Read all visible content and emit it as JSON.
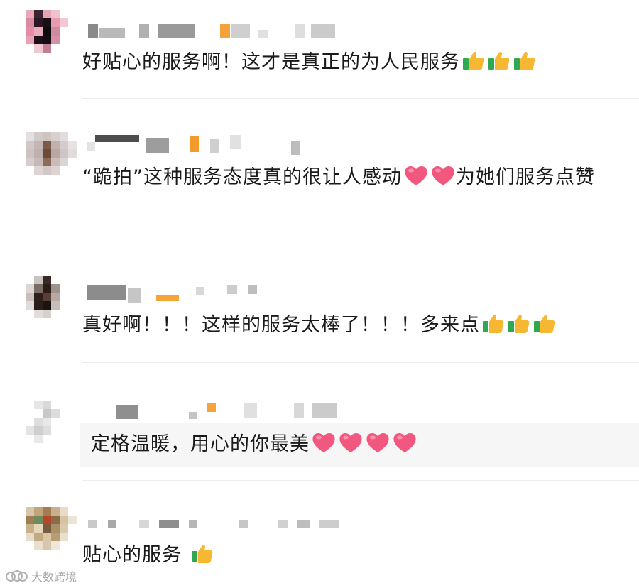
{
  "comments": [
    {
      "text": "好贴心的服务啊！这才是真正的为人民服务",
      "emoji": [
        "thumbs-up",
        "thumbs-up",
        "thumbs-up"
      ]
    },
    {
      "text": "“跪拍”这种服务态度真的很让人感动",
      "emoji_mid": [
        "heart",
        "heart"
      ],
      "text_after": "为她们服务点赞"
    },
    {
      "text": "真好啊！！！这样的服务太棒了！！！多来点",
      "emoji": [
        "thumbs-up",
        "thumbs-up",
        "thumbs-up"
      ]
    },
    {
      "text": "定格温暖，用心的你最美",
      "emoji": [
        "heart",
        "heart",
        "heart",
        "heart"
      ]
    },
    {
      "text": "贴心的服务 ",
      "emoji": [
        "thumbs-up"
      ]
    }
  ],
  "watermark": {
    "text": "大数跨境"
  },
  "colors": {
    "text": "#1a1a1a",
    "divider": "#ececec",
    "heart": "#f2587f",
    "thumb": "#f6b732",
    "cuff": "#2fa84f"
  }
}
